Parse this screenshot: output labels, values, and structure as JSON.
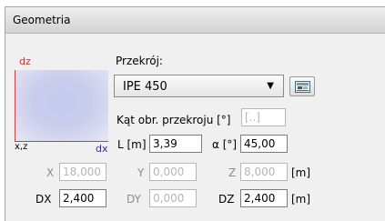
{
  "panel": {
    "title": "Geometria"
  },
  "preview": {
    "axis_dz": "dz",
    "axis_dx": "dx",
    "axis_xz": "x,z"
  },
  "section": {
    "label": "Przekrój:",
    "selected": "IPE 450",
    "angle_label": "Kąt obr. przekroju [°]",
    "angle_value": "[..]"
  },
  "length": {
    "label": "L [m]",
    "value": "3,39"
  },
  "alpha": {
    "label": "α [°]",
    "value": "45,00"
  },
  "coords": {
    "x_label": "X",
    "x_value": "18,000",
    "y_label": "Y",
    "y_value": "0,000",
    "z_label": "Z",
    "z_value": "8,000",
    "unit": "[m]"
  },
  "deltas": {
    "dx_label": "DX",
    "dx_value": "2,400",
    "dy_label": "DY",
    "dy_value": "0,000",
    "dz_label": "DZ",
    "dz_value": "2,400",
    "unit": "[m]"
  },
  "icons": {
    "section_library": "section-library-icon",
    "dropdown": "chevron-down-icon"
  },
  "colors": {
    "axis_dz": "#d23131",
    "axis_dx": "#2b2ba6",
    "preview_fill": "#c6cbee"
  }
}
